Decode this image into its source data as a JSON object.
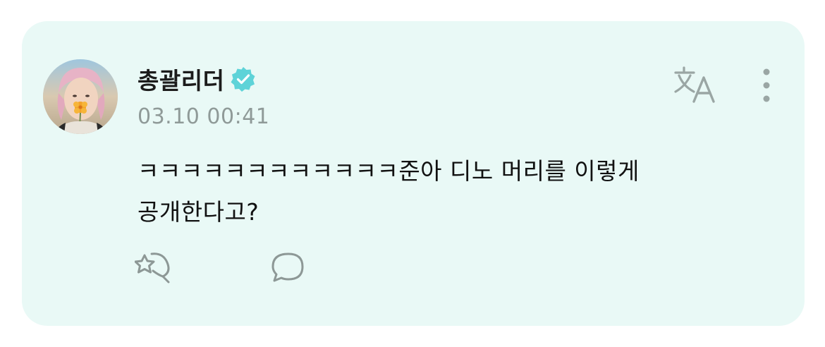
{
  "post": {
    "author_name": "총괄리더",
    "verified": true,
    "timestamp": "03.10 00:41",
    "message_line1": "ㅋㅋㅋㅋㅋㅋㅋㅋㅋㅋㅋㅋ준아 디노 머리를 이렇게",
    "message_line2": "공개한다고?"
  },
  "icons": {
    "avatar": "profile-photo",
    "verified": "verified-badge-icon",
    "translate": "translate-icon",
    "more": "more-vertical-icon",
    "react": "star-heart-react-icon",
    "comment": "comment-bubble-icon"
  },
  "colors": {
    "card_background": "#e9f9f6",
    "verified_badge": "#5ed3d8",
    "icon_gray": "#9aa6a4",
    "timestamp": "#8f9a98",
    "text": "#111111"
  }
}
